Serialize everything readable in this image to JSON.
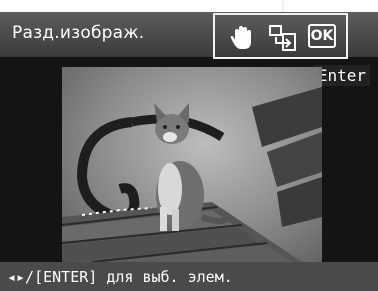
{
  "header": {
    "title": "Разд.изображ.",
    "icons": [
      "hand-icon",
      "edit-move-icon"
    ],
    "ok_label": "OK"
  },
  "enter_label": "Enter",
  "photo": {
    "subject": "cat sitting on a wooden bench",
    "bench_color": "#4a4a4a"
  },
  "footer": {
    "hint": "◂▸/[ENTER] для выб. элем."
  },
  "colors": {
    "background": "#141414",
    "header": "#4a4a4a",
    "text": "#ffffff"
  }
}
